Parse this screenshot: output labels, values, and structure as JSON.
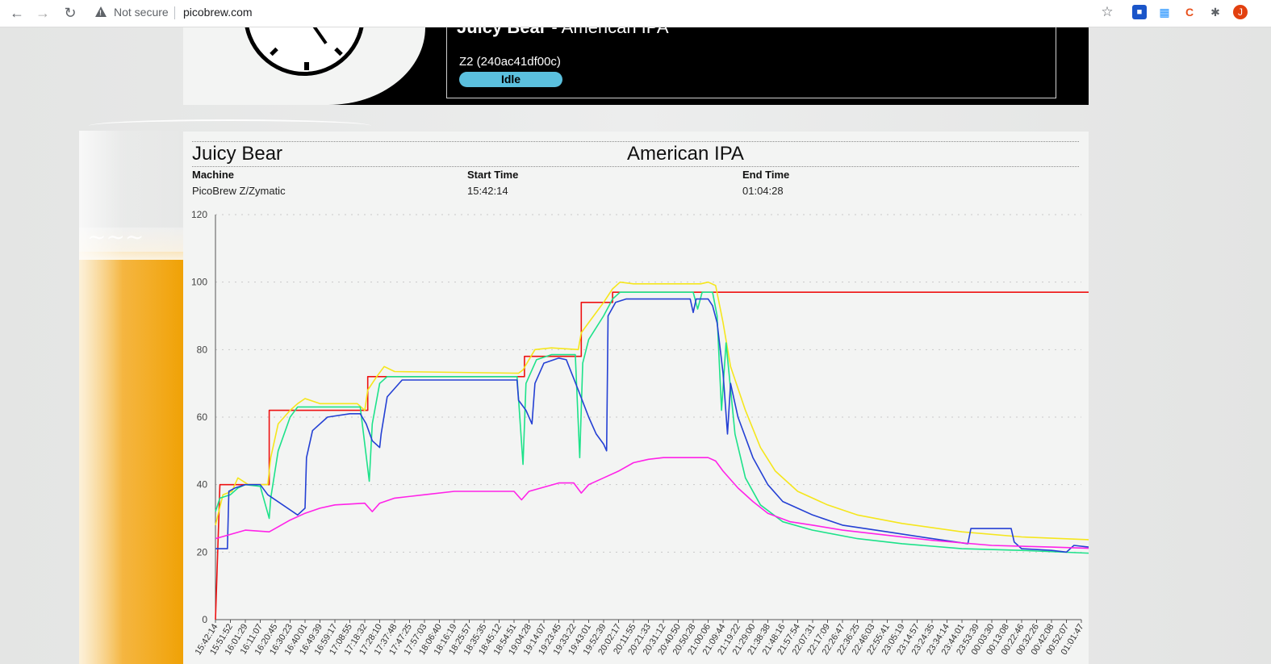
{
  "browser": {
    "back_icon": "arrow-left-icon",
    "forward_icon": "arrow-right-icon",
    "reload_icon": "reload-icon",
    "security_label": "Not secure",
    "url": "picobrew.com",
    "profile_initial": "J"
  },
  "status_card": {
    "brew_name": "Juicy Bear",
    "brew_style": "American IPA",
    "machine": "Z2 (240ac41df00c)",
    "state": "Idle",
    "state_color": "#5bc0de"
  },
  "session": {
    "name": "Juicy Bear",
    "style": "American IPA",
    "machine_label": "Machine",
    "machine_value": "PicoBrew Z/Zymatic",
    "start_label": "Start Time",
    "start_value": "15:42:14",
    "end_label": "End Time",
    "end_value": "01:04:28"
  },
  "chart_data": {
    "type": "line",
    "title": "",
    "xlabel": "",
    "ylabel": "",
    "ylim": [
      0,
      120
    ],
    "yticks": [
      0,
      20,
      40,
      60,
      80,
      100,
      120
    ],
    "grid": "horizontal dotted",
    "x_is_time": true,
    "categories": [
      "15:42:14",
      "15:51:52",
      "16:01:29",
      "16:11:07",
      "16:20:45",
      "16:30:23",
      "16:40:01",
      "16:49:39",
      "16:59:17",
      "17:08:55",
      "17:18:32",
      "17:28:10",
      "17:37:48",
      "17:47:25",
      "17:57:03",
      "18:06:40",
      "18:16:19",
      "18:25:57",
      "18:35:35",
      "18:45:12",
      "18:54:51",
      "19:04:28",
      "19:14:07",
      "19:23:45",
      "19:33:22",
      "19:43:01",
      "19:52:39",
      "20:02:17",
      "20:11:55",
      "20:21:33",
      "20:31:12",
      "20:40:50",
      "20:50:28",
      "21:00:06",
      "21:09:44",
      "21:19:22",
      "21:29:00",
      "21:38:38",
      "21:48:16",
      "21:57:54",
      "22:07:31",
      "22:17:09",
      "22:26:47",
      "22:36:25",
      "22:46:03",
      "22:55:41",
      "23:05:19",
      "23:14:57",
      "23:24:35",
      "23:34:14",
      "23:44:01",
      "23:53:39",
      "00:03:30",
      "00:13:08",
      "00:22:46",
      "00:32:26",
      "00:42:08",
      "00:52:07",
      "01:01:47"
    ],
    "series": [
      {
        "color": "#e11",
        "points": [
          [
            0,
            0
          ],
          [
            0.3,
            40
          ],
          [
            3.6,
            40
          ],
          [
            3.6,
            62
          ],
          [
            10.2,
            62
          ],
          [
            10.2,
            72
          ],
          [
            20.7,
            72
          ],
          [
            20.7,
            78
          ],
          [
            24.5,
            78
          ],
          [
            24.5,
            94
          ],
          [
            26.6,
            94
          ],
          [
            26.6,
            97
          ],
          [
            59.5,
            97
          ]
        ]
      },
      {
        "color": "#f5e61c",
        "points": [
          [
            0,
            28
          ],
          [
            0.5,
            37
          ],
          [
            1.1,
            38
          ],
          [
            1.5,
            42
          ],
          [
            2.2,
            40
          ],
          [
            3.5,
            40
          ],
          [
            3.7,
            48
          ],
          [
            4.2,
            58
          ],
          [
            5.0,
            62
          ],
          [
            5.5,
            64
          ],
          [
            6.0,
            65.5
          ],
          [
            7.0,
            64
          ],
          [
            9.5,
            64
          ],
          [
            10.0,
            62
          ],
          [
            10.2,
            68
          ],
          [
            10.8,
            72
          ],
          [
            11.3,
            75
          ],
          [
            12.0,
            73.5
          ],
          [
            20.3,
            73
          ],
          [
            20.6,
            74
          ],
          [
            21.4,
            80
          ],
          [
            22.5,
            80.5
          ],
          [
            24.3,
            80
          ],
          [
            24.5,
            85
          ],
          [
            25.0,
            88
          ],
          [
            26.0,
            94
          ],
          [
            26.6,
            98
          ],
          [
            27.1,
            100
          ],
          [
            28.0,
            99.5
          ],
          [
            32.5,
            99.5
          ],
          [
            33.0,
            100
          ],
          [
            33.5,
            99
          ],
          [
            34.0,
            88
          ],
          [
            34.5,
            75
          ],
          [
            35.5,
            62
          ],
          [
            36.5,
            51
          ],
          [
            37.5,
            44
          ],
          [
            39.0,
            38
          ],
          [
            41.0,
            34
          ],
          [
            43.0,
            31
          ],
          [
            46.0,
            28.5
          ],
          [
            50.0,
            26
          ],
          [
            54.0,
            24.5
          ],
          [
            59.5,
            23.5
          ]
        ]
      },
      {
        "color": "#1de28a",
        "points": [
          [
            0,
            32
          ],
          [
            0.3,
            36
          ],
          [
            1.0,
            37
          ],
          [
            1.5,
            39
          ],
          [
            2.0,
            40
          ],
          [
            3.0,
            39.5
          ],
          [
            3.6,
            30
          ],
          [
            3.7,
            36
          ],
          [
            4.2,
            50
          ],
          [
            5.0,
            60
          ],
          [
            5.5,
            63
          ],
          [
            9.7,
            63
          ],
          [
            10.3,
            41
          ],
          [
            10.5,
            58
          ],
          [
            11.0,
            70
          ],
          [
            11.5,
            72
          ],
          [
            20.2,
            72
          ],
          [
            20.6,
            46
          ],
          [
            20.8,
            70
          ],
          [
            21.5,
            77
          ],
          [
            22.5,
            78.5
          ],
          [
            24.1,
            78.5
          ],
          [
            24.4,
            48
          ],
          [
            24.6,
            76
          ],
          [
            25.0,
            83
          ],
          [
            26.0,
            90
          ],
          [
            26.6,
            95
          ],
          [
            27.1,
            97
          ],
          [
            32.0,
            97
          ],
          [
            32.3,
            92
          ],
          [
            32.6,
            97
          ],
          [
            33.3,
            97
          ],
          [
            33.6,
            90
          ],
          [
            33.9,
            62
          ],
          [
            34.2,
            82
          ],
          [
            34.8,
            55
          ],
          [
            35.5,
            42
          ],
          [
            36.5,
            34
          ],
          [
            38.0,
            29
          ],
          [
            40.0,
            26.5
          ],
          [
            43.0,
            24
          ],
          [
            46.0,
            22.5
          ],
          [
            50.0,
            21
          ],
          [
            54.0,
            20.5
          ],
          [
            59.5,
            19.5
          ]
        ]
      },
      {
        "color": "#2440d4",
        "points": [
          [
            0,
            21
          ],
          [
            0.8,
            21
          ],
          [
            0.9,
            38
          ],
          [
            1.3,
            39
          ],
          [
            2.0,
            40
          ],
          [
            3.0,
            40
          ],
          [
            3.5,
            37
          ],
          [
            5.5,
            31
          ],
          [
            6.0,
            33
          ],
          [
            6.1,
            48
          ],
          [
            6.5,
            56
          ],
          [
            7.5,
            60
          ],
          [
            9.0,
            61
          ],
          [
            9.7,
            61
          ],
          [
            10.1,
            58
          ],
          [
            10.5,
            53
          ],
          [
            11.0,
            51
          ],
          [
            11.1,
            55
          ],
          [
            11.5,
            66
          ],
          [
            12.5,
            71
          ],
          [
            20.2,
            71
          ],
          [
            20.3,
            65
          ],
          [
            20.8,
            62
          ],
          [
            21.2,
            58
          ],
          [
            21.4,
            70
          ],
          [
            22.0,
            76
          ],
          [
            23.0,
            77.5
          ],
          [
            23.5,
            77
          ],
          [
            24.3,
            68
          ],
          [
            25.0,
            60
          ],
          [
            25.5,
            55
          ],
          [
            26.0,
            52
          ],
          [
            26.2,
            50
          ],
          [
            26.3,
            90
          ],
          [
            26.8,
            94
          ],
          [
            27.5,
            95
          ],
          [
            31.8,
            95
          ],
          [
            32.0,
            91
          ],
          [
            32.2,
            95
          ],
          [
            33.0,
            95
          ],
          [
            33.3,
            93
          ],
          [
            33.6,
            88
          ],
          [
            34.0,
            73
          ],
          [
            34.3,
            55
          ],
          [
            34.5,
            70
          ],
          [
            35.0,
            60
          ],
          [
            36.0,
            48
          ],
          [
            37.0,
            40
          ],
          [
            38.0,
            35
          ],
          [
            40.0,
            31
          ],
          [
            42.0,
            28
          ],
          [
            45.0,
            26
          ],
          [
            48.0,
            24
          ],
          [
            50.4,
            22.5
          ],
          [
            50.6,
            27
          ],
          [
            53.3,
            27
          ],
          [
            53.5,
            23
          ],
          [
            54.0,
            21
          ],
          [
            56.0,
            20.5
          ],
          [
            57.0,
            20
          ],
          [
            57.5,
            22
          ],
          [
            58.5,
            21.5
          ]
        ]
      },
      {
        "color": "#ff22e8",
        "points": [
          [
            0,
            24
          ],
          [
            2.0,
            26.5
          ],
          [
            3.6,
            26
          ],
          [
            4.0,
            27
          ],
          [
            5.0,
            29.5
          ],
          [
            6.0,
            31.5
          ],
          [
            7.0,
            33
          ],
          [
            8.0,
            34
          ],
          [
            10.0,
            34.5
          ],
          [
            10.5,
            32
          ],
          [
            11.0,
            34.5
          ],
          [
            12.0,
            36
          ],
          [
            14.0,
            37
          ],
          [
            16.0,
            38
          ],
          [
            20.0,
            38
          ],
          [
            20.5,
            35.5
          ],
          [
            21.0,
            38
          ],
          [
            23.0,
            40.5
          ],
          [
            24.0,
            40.5
          ],
          [
            24.5,
            37.5
          ],
          [
            25.0,
            40
          ],
          [
            26.0,
            42
          ],
          [
            27.0,
            44
          ],
          [
            28.0,
            46.5
          ],
          [
            29.0,
            47.5
          ],
          [
            30.0,
            48
          ],
          [
            33.0,
            48
          ],
          [
            33.5,
            47
          ],
          [
            34.0,
            44
          ],
          [
            35.0,
            39
          ],
          [
            36.0,
            35
          ],
          [
            37.0,
            31.5
          ],
          [
            38.5,
            29
          ],
          [
            40.0,
            28
          ],
          [
            42.0,
            26.5
          ],
          [
            45.0,
            25
          ],
          [
            48.0,
            23.5
          ],
          [
            52.0,
            22
          ],
          [
            56.0,
            21.5
          ],
          [
            59.5,
            21
          ]
        ]
      }
    ]
  }
}
